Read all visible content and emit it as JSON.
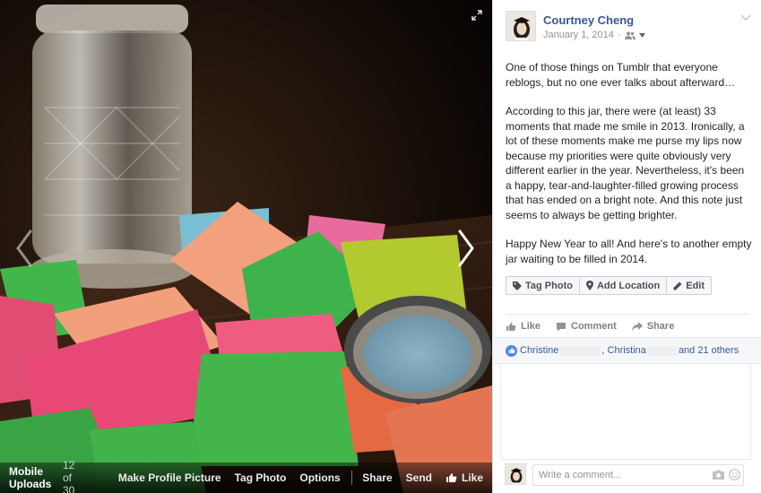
{
  "photo": {
    "album": "Mobile Uploads",
    "position": "12 of 30",
    "actions": [
      "Make Profile Picture",
      "Tag Photo",
      "Options",
      "Share",
      "Send",
      "Like"
    ]
  },
  "post": {
    "author": "Courtney Cheng",
    "date": "January 1, 2014",
    "audience_icon": "friends-icon",
    "paragraphs": [
      "One of those things on Tumblr that everyone reblogs, but no one ever talks about afterward…",
      "According to this jar, there were (at least) 33 moments that made me smile in 2013. Ironically, a lot of these moments make me purse my lips now because my priorities were quite obviously very different earlier in the year. Nevertheless, it's been a happy, tear-and-laughter-filled growing process that has ended on a bright note. And this note just seems to always be getting brighter.",
      "Happy New Year to all! And here's to another empty jar waiting to be filled in 2014."
    ]
  },
  "tag_buttons": {
    "tag_photo": "Tag Photo",
    "add_location": "Add Location",
    "edit": "Edit"
  },
  "actions": {
    "like": "Like",
    "comment": "Comment",
    "share": "Share"
  },
  "likes": {
    "name1": "Christine",
    "name2": ", Christina",
    "others": "and 21 others"
  },
  "comment": {
    "placeholder": "Write a comment..."
  },
  "colors": {
    "link": "#365899",
    "meta": "#90949c",
    "like_badge": "#4d88e6"
  }
}
